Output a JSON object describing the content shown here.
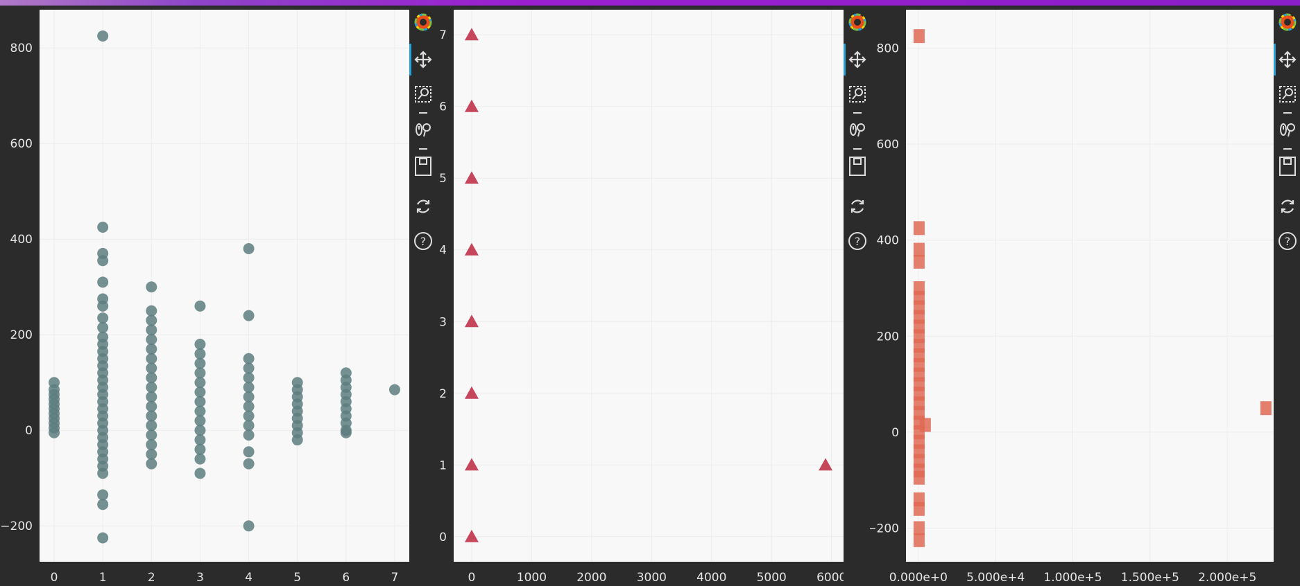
{
  "chart_data": [
    {
      "type": "scatter",
      "marker": "circle",
      "color": "#5d7e7f",
      "xlim": [
        -0.3,
        7.3
      ],
      "ylim": [
        -275,
        880
      ],
      "x_ticks": [
        "0",
        "1",
        "2",
        "3",
        "4",
        "5",
        "6",
        "7"
      ],
      "y_ticks": [
        "−200",
        "0",
        "200",
        "400",
        "600",
        "800"
      ],
      "series": [
        {
          "points": [
            [
              0,
              -5
            ],
            [
              0,
              5
            ],
            [
              0,
              15
            ],
            [
              0,
              25
            ],
            [
              0,
              35
            ],
            [
              0,
              45
            ],
            [
              0,
              55
            ],
            [
              0,
              65
            ],
            [
              0,
              75
            ],
            [
              0,
              85
            ],
            [
              0,
              100
            ],
            [
              1,
              825
            ],
            [
              1,
              425
            ],
            [
              1,
              370
            ],
            [
              1,
              355
            ],
            [
              1,
              310
            ],
            [
              1,
              275
            ],
            [
              1,
              260
            ],
            [
              1,
              235
            ],
            [
              1,
              215
            ],
            [
              1,
              195
            ],
            [
              1,
              180
            ],
            [
              1,
              165
            ],
            [
              1,
              150
            ],
            [
              1,
              135
            ],
            [
              1,
              120
            ],
            [
              1,
              105
            ],
            [
              1,
              90
            ],
            [
              1,
              75
            ],
            [
              1,
              60
            ],
            [
              1,
              45
            ],
            [
              1,
              30
            ],
            [
              1,
              15
            ],
            [
              1,
              0
            ],
            [
              1,
              -15
            ],
            [
              1,
              -30
            ],
            [
              1,
              -45
            ],
            [
              1,
              -60
            ],
            [
              1,
              -75
            ],
            [
              1,
              -90
            ],
            [
              1,
              -135
            ],
            [
              1,
              -155
            ],
            [
              1,
              -225
            ],
            [
              2,
              300
            ],
            [
              2,
              250
            ],
            [
              2,
              230
            ],
            [
              2,
              210
            ],
            [
              2,
              190
            ],
            [
              2,
              170
            ],
            [
              2,
              150
            ],
            [
              2,
              130
            ],
            [
              2,
              110
            ],
            [
              2,
              90
            ],
            [
              2,
              70
            ],
            [
              2,
              50
            ],
            [
              2,
              30
            ],
            [
              2,
              10
            ],
            [
              2,
              -10
            ],
            [
              2,
              -30
            ],
            [
              2,
              -50
            ],
            [
              2,
              -70
            ],
            [
              3,
              260
            ],
            [
              3,
              180
            ],
            [
              3,
              160
            ],
            [
              3,
              140
            ],
            [
              3,
              120
            ],
            [
              3,
              100
            ],
            [
              3,
              80
            ],
            [
              3,
              60
            ],
            [
              3,
              40
            ],
            [
              3,
              20
            ],
            [
              3,
              0
            ],
            [
              3,
              -20
            ],
            [
              3,
              -40
            ],
            [
              3,
              -60
            ],
            [
              3,
              -90
            ],
            [
              4,
              380
            ],
            [
              4,
              240
            ],
            [
              4,
              150
            ],
            [
              4,
              130
            ],
            [
              4,
              110
            ],
            [
              4,
              90
            ],
            [
              4,
              70
            ],
            [
              4,
              50
            ],
            [
              4,
              30
            ],
            [
              4,
              10
            ],
            [
              4,
              -10
            ],
            [
              4,
              -45
            ],
            [
              4,
              -70
            ],
            [
              4,
              -200
            ],
            [
              5,
              100
            ],
            [
              5,
              85
            ],
            [
              5,
              70
            ],
            [
              5,
              55
            ],
            [
              5,
              40
            ],
            [
              5,
              25
            ],
            [
              5,
              10
            ],
            [
              5,
              -5
            ],
            [
              5,
              -20
            ],
            [
              6,
              120
            ],
            [
              6,
              105
            ],
            [
              6,
              90
            ],
            [
              6,
              75
            ],
            [
              6,
              60
            ],
            [
              6,
              45
            ],
            [
              6,
              30
            ],
            [
              6,
              15
            ],
            [
              6,
              0
            ],
            [
              6,
              -5
            ],
            [
              7,
              85
            ]
          ]
        }
      ]
    },
    {
      "type": "scatter",
      "marker": "triangle",
      "color": "#c0324a",
      "xlim": [
        -300,
        6200
      ],
      "ylim": [
        -0.35,
        7.35
      ],
      "x_ticks": [
        "0",
        "1000",
        "2000",
        "3000",
        "4000",
        "5000",
        "6000"
      ],
      "y_ticks": [
        "0",
        "1",
        "2",
        "3",
        "4",
        "5",
        "6",
        "7"
      ],
      "series": [
        {
          "points": [
            [
              0,
              0
            ],
            [
              0,
              1
            ],
            [
              0,
              2
            ],
            [
              0,
              3
            ],
            [
              0,
              4
            ],
            [
              0,
              5
            ],
            [
              0,
              6
            ],
            [
              0,
              7
            ],
            [
              5900,
              1
            ]
          ]
        }
      ]
    },
    {
      "type": "scatter",
      "marker": "square",
      "color": "#e06a55",
      "xlim": [
        -8000,
        230000
      ],
      "ylim": [
        -270,
        880
      ],
      "x_ticks": [
        "0.000e+0",
        "5.000e+4",
        "1.000e+5",
        "1.500e+5",
        "2.000e+5"
      ],
      "y_ticks": [
        "−200",
        "0",
        "200",
        "400",
        "800",
        "600"
      ],
      "series": [
        {
          "points": [
            [
              500,
              825
            ],
            [
              500,
              425
            ],
            [
              500,
              380
            ],
            [
              500,
              355
            ],
            [
              500,
              300
            ],
            [
              500,
              280
            ],
            [
              500,
              260
            ],
            [
              500,
              240
            ],
            [
              500,
              220
            ],
            [
              500,
              200
            ],
            [
              500,
              180
            ],
            [
              500,
              160
            ],
            [
              500,
              140
            ],
            [
              500,
              120
            ],
            [
              500,
              100
            ],
            [
              500,
              80
            ],
            [
              500,
              60
            ],
            [
              500,
              40
            ],
            [
              500,
              20
            ],
            [
              500,
              0
            ],
            [
              500,
              -20
            ],
            [
              500,
              -40
            ],
            [
              500,
              -60
            ],
            [
              500,
              -80
            ],
            [
              500,
              -95
            ],
            [
              500,
              -140
            ],
            [
              500,
              -160
            ],
            [
              500,
              -200
            ],
            [
              500,
              -225
            ],
            [
              4500,
              15
            ],
            [
              225000,
              50
            ]
          ]
        }
      ]
    }
  ]
}
